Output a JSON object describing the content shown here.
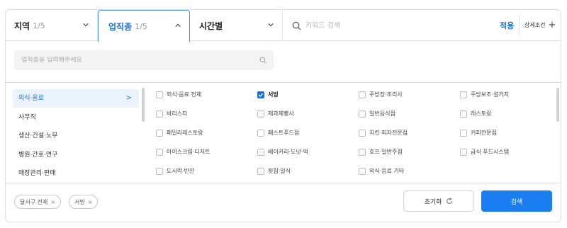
{
  "filters": {
    "region": {
      "label": "지역",
      "count": "1/5"
    },
    "job": {
      "label": "업직종",
      "count": "1/5"
    },
    "time": {
      "label": "시간별"
    },
    "keyword_placeholder": "키워드 검색",
    "apply_label": "적용",
    "advanced_label": "상세조건",
    "advanced_icon": "+"
  },
  "job_search": {
    "placeholder": "업직종을 입력해주세요"
  },
  "categories": [
    {
      "label": "외식·음료",
      "active": true,
      "arrow": ">"
    },
    {
      "label": "사무직"
    },
    {
      "label": "생산·건설·노무"
    },
    {
      "label": "병원·간호·연구"
    },
    {
      "label": "매장관리·판매"
    }
  ],
  "subcategories": [
    {
      "label": "외식·음료 전체",
      "checked": false
    },
    {
      "label": "서빙",
      "checked": true
    },
    {
      "label": "주방장·조리사",
      "checked": false
    },
    {
      "label": "주방보조·설거지",
      "checked": false
    },
    {
      "label": "바리스타",
      "checked": false
    },
    {
      "label": "제과제빵사",
      "checked": false
    },
    {
      "label": "일반음식점",
      "checked": false
    },
    {
      "label": "레스토랑",
      "checked": false
    },
    {
      "label": "패밀리레스토랑",
      "checked": false
    },
    {
      "label": "패스트푸드점",
      "checked": false
    },
    {
      "label": "치킨·피자전문점",
      "checked": false
    },
    {
      "label": "커피전문점",
      "checked": false
    },
    {
      "label": "아이스크림·디저트",
      "checked": false
    },
    {
      "label": "베이커리·도넛·떡",
      "checked": false
    },
    {
      "label": "호프·일반주점",
      "checked": false
    },
    {
      "label": "급식·푸드시스템",
      "checked": false
    },
    {
      "label": "도시락·반찬",
      "checked": false
    },
    {
      "label": "횟집·일식",
      "checked": false
    },
    {
      "label": "외식·음료 기타",
      "checked": false
    }
  ],
  "selected_chips": [
    {
      "label": "달서구 전체",
      "remove": "×"
    },
    {
      "label": "서빙",
      "remove": "×"
    }
  ],
  "buttons": {
    "reset_label": "초기화",
    "search_label": "검색"
  },
  "colors": {
    "accent": "#1a73d9",
    "search_button": "#1a7ef0"
  }
}
